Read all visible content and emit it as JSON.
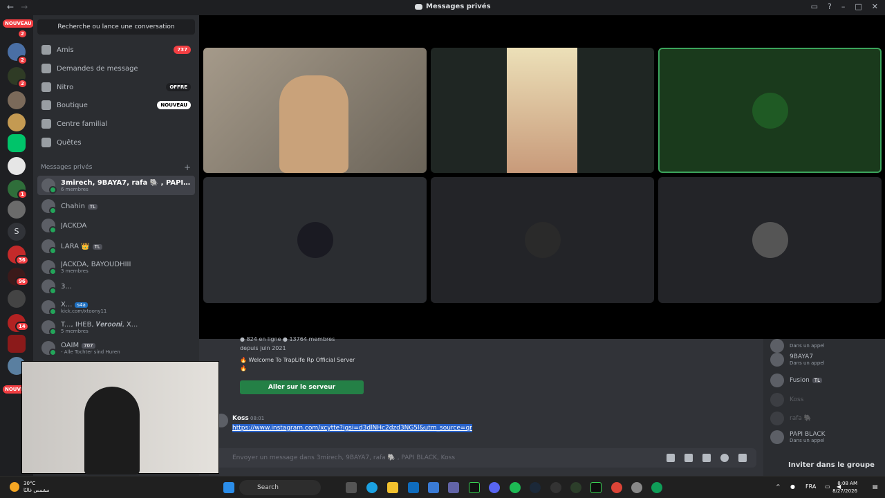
{
  "window": {
    "title": "Messages privés"
  },
  "rail": {
    "new_label": "NOUVEAU",
    "new_label_bottom": "NOUVEAU",
    "letter_server": "S",
    "badges": [
      "2",
      "2",
      "2",
      "1",
      "36",
      "96",
      "14"
    ]
  },
  "sidebar": {
    "search_placeholder": "Recherche ou lance une conversation",
    "nav": [
      {
        "label": "Amis",
        "tag": "737"
      },
      {
        "label": "Demandes de message",
        "tag": ""
      },
      {
        "label": "Nitro",
        "tag": "OFFRE"
      },
      {
        "label": "Boutique",
        "tag": "NOUVEAU"
      },
      {
        "label": "Centre familial",
        "tag": ""
      },
      {
        "label": "Quêtes",
        "tag": ""
      }
    ],
    "dm_header": "Messages privés",
    "dms": [
      {
        "name": "3mirech, 9BAYA7, rafa 🐘 , PAPI BLACK,...",
        "sub": "6 membres"
      },
      {
        "name": "Chahin",
        "tag": "TL",
        "sub": ""
      },
      {
        "name": "JACKDA",
        "sub": ""
      },
      {
        "name": "LARA 👑",
        "tag": "TL",
        "sub": ""
      },
      {
        "name": "JACKDA, BAYOUDHIII",
        "sub": "3 membres"
      },
      {
        "name": "3...",
        "sub": ""
      },
      {
        "name": "X...",
        "tag": "s4a",
        "sub": "kick.com/xtoony11"
      },
      {
        "name": "T..., IHEB, 𝑽𝒆𝒓𝒐𝒐𝒏𝒊, X...",
        "sub": "5 membres"
      },
      {
        "name": "OAIM",
        "tag": "707",
        "sub": "- Alle Tochter sind Huren"
      }
    ]
  },
  "chat": {
    "server_stats": "● 824 en ligne  ● 13764 membres",
    "server_since": "depuis juin 2021",
    "server_welcome": "🔥 Welcome To TrapLife Rp Official Server",
    "server_fire": "🔥",
    "join_button": "Aller sur le serveur",
    "message": {
      "author": "Koss",
      "time": "08:01",
      "link": "https://www.instagram.com/xcytte?igsi=d3dlNHc2dzd3NG5l&utm_source=qr"
    },
    "composer_placeholder": "Envoyer un message dans 3mirech, 9BAYA7, rafa 🐘 , PAPI BLACK, Koss"
  },
  "members": [
    {
      "name": "",
      "status": "Dans un appel"
    },
    {
      "name": "9BAYA7",
      "status": "Dans un appel"
    },
    {
      "name": "Fusion",
      "tag": "TL",
      "status": ""
    },
    {
      "name": "Koss",
      "status": ""
    },
    {
      "name": "rafa 🐘",
      "status": ""
    },
    {
      "name": "PAPI BLACK",
      "status": "Dans un appel"
    }
  ],
  "invite_button": "Inviter dans le groupe p...",
  "taskbar": {
    "weather_temp": "30°C",
    "weather_desc": "مشمس غالبًا",
    "search": "Search",
    "lang": "FRA",
    "time": "8:08 AM",
    "date": "8/27/2026"
  },
  "colors": {
    "accent": "#248046",
    "speaking_border": "#3ba55c",
    "mention_badge": "#f23f43",
    "blurple": "#5865f2"
  }
}
